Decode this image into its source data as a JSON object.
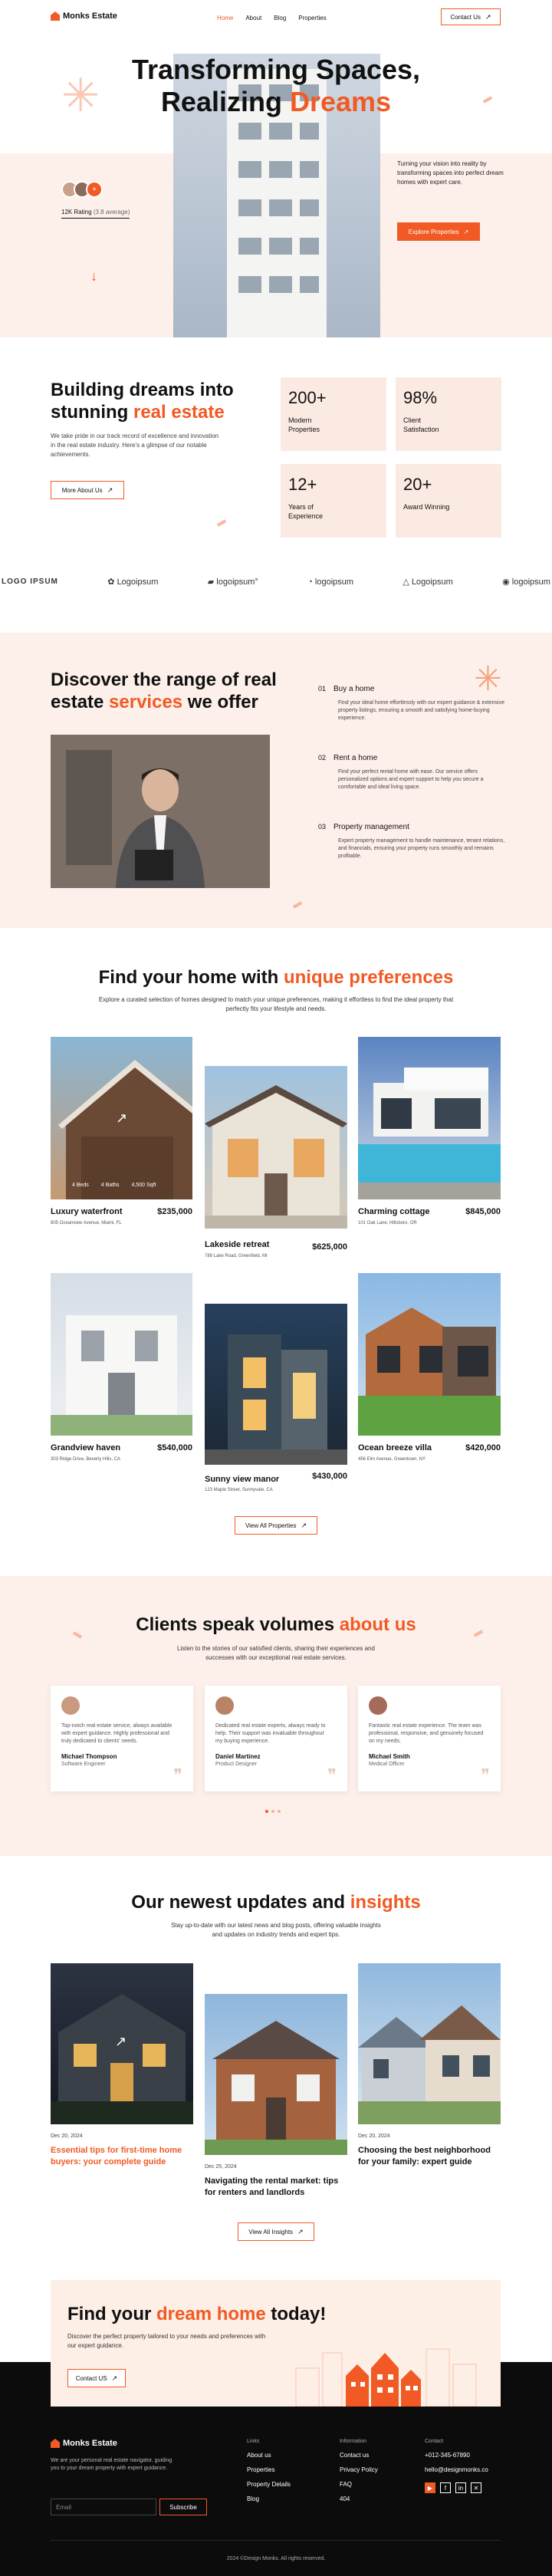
{
  "header": {
    "brand": "Monks Estate",
    "nav": [
      "Home",
      "About",
      "Blog",
      "Properties"
    ],
    "contact": "Contact Us"
  },
  "hero": {
    "title_line1": "Transforming Spaces,",
    "title_line2a": "Realizing ",
    "title_line2b": "Dreams",
    "rating": "12K Rating",
    "rating_sub": "(3.8 average)",
    "plus": "+",
    "desc": "Turning your vision into reality by transforming spaces into perfect dream homes with expert care.",
    "cta": "Explore Properties"
  },
  "about": {
    "title_a": "Building dreams into",
    "title_b": "stunning ",
    "title_c": "real estate",
    "desc": "We take pride in our track record of excellence and innovation in the real estate industry. Here's a glimpse of our notable achievements.",
    "cta": "More About Us",
    "stats": [
      {
        "value": "200+",
        "label": "Modern Properties"
      },
      {
        "value": "98%",
        "label": "Client Satisfaction"
      },
      {
        "value": "12+",
        "label": "Years of Experience"
      },
      {
        "value": "20+",
        "label": "Award Winning"
      }
    ]
  },
  "logos": [
    "LOGO IPSUM",
    "Logoipsum",
    "logoipsum°",
    "logoipsum",
    "Logoipsum",
    "logoipsum"
  ],
  "services": {
    "title_a": "Discover the range of real",
    "title_b": "estate ",
    "title_c": "services",
    "title_d": " we offer",
    "items": [
      {
        "num": "01",
        "title": "Buy a home",
        "text": "Find your ideal home effortlessly with our expert guidance & extensive property listings, ensuring a smooth and satisfying home-buying experience."
      },
      {
        "num": "02",
        "title": "Rent a home",
        "text": "Find your perfect rental home with ease. Our service offers personalized options and expert support to help you secure a comfortable and ideal living space."
      },
      {
        "num": "03",
        "title": "Property management",
        "text": "Expert property management to handle maintenance, tenant relations, and financials, ensuring your property runs smoothly and remains profitable."
      }
    ]
  },
  "properties": {
    "title_a": "Find your home with ",
    "title_b": "unique preferences",
    "desc": "Explore a curated selection of homes designed to match your unique preferences, making it effortless to find the ideal property that perfectly fits your lifestyle and needs.",
    "overlay": {
      "beds": "4 Beds",
      "baths": "4 Baths",
      "size": "4,500 Sqft"
    },
    "items": [
      {
        "name": "Luxury waterfront",
        "price": "$235,000",
        "addr": "805 Oceanview Avenue, Miami, FL"
      },
      {
        "name": "Lakeside retreat",
        "price": "$625,000",
        "addr": "789 Lake Road, Greenfield, MI"
      },
      {
        "name": "Charming cottage",
        "price": "$845,000",
        "addr": "101 Oak Lane, Hillsboro, OR"
      },
      {
        "name": "Grandview haven",
        "price": "$540,000",
        "addr": "303 Ridge Drive, Beverly Hills, CA"
      },
      {
        "name": "Sunny view manor",
        "price": "$430,000",
        "addr": "123 Maple Street, Sunnyvale, CA"
      },
      {
        "name": "Ocean breeze villa",
        "price": "$420,000",
        "addr": "456 Elm Avenue, Greentown, NY"
      }
    ],
    "cta": "View All Properties"
  },
  "testimonials": {
    "title_a": "Clients speak volumes ",
    "title_b": "about us",
    "desc": "Listen to the stories of our satisfied clients, sharing their experiences and successes with our exceptional real estate services.",
    "items": [
      {
        "text": "Top-notch real estate service, always available with expert guidance. Highly professional and truly dedicated to clients' needs.",
        "name": "Michael Thompson",
        "role": "Software Engineer"
      },
      {
        "text": "Dedicated real estate experts, always ready to help. Their support was invaluable throughout my buying experience.",
        "name": "Daniel Martinez",
        "role": "Product Designer"
      },
      {
        "text": "Fantastic real estate experience. The team was professional, responsive, and genuinely focused on my needs.",
        "name": "Michael Smith",
        "role": "Medical Officer"
      }
    ]
  },
  "blog": {
    "title_a": "Our newest updates and ",
    "title_b": "insights",
    "desc": "Stay up-to-date with our latest news and blog posts, offering valuable insights and updates on industry trends and expert tips.",
    "items": [
      {
        "date": "Dec 20, 2024",
        "title": "Essential tips for first-time home buyers: your complete guide"
      },
      {
        "date": "Dec 25, 2024",
        "title": "Navigating the rental market: tips for renters and landlords"
      },
      {
        "date": "Dec 20, 2024",
        "title": "Choosing the best neighborhood for your family: expert guide"
      }
    ],
    "cta": "View All Insights"
  },
  "cta": {
    "title_a": "Find your ",
    "title_b": "dream home",
    "title_c": " today!",
    "desc": "Discover the perfect property tailored to your needs and preferences with our expert guidance.",
    "button": "Contact US"
  },
  "footer": {
    "brand": "Monks Estate",
    "desc": "We are your personal real estate navigator, guiding you to your dream property with expert guidance.",
    "email_placeholder": "Email",
    "subscribe": "Subscribe",
    "links_head": "Links",
    "links": [
      "About us",
      "Properties",
      "Property Details",
      "Blog"
    ],
    "info_head": "Information",
    "info": [
      "Contact us",
      "Privacy Policy",
      "FAQ",
      "404"
    ],
    "contact_head": "Contact",
    "phone": "+012-345-67890",
    "email": "hello@designmonks.co",
    "copyright": "2024 ©Design Monks. All rights reserved."
  }
}
